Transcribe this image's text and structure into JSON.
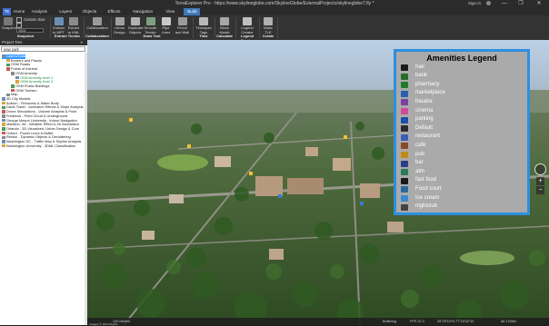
{
  "window": {
    "title": "TerraExplorer Pro - https://www.skylineglobe.com/SkylineGlobe/ExternalProjects/skylineglobe7.fly *",
    "sign_in": "Sign In",
    "minimize": "—",
    "maximize": "❐",
    "close": "✕"
  },
  "menu": {
    "logo": "TE",
    "items": [
      "Home",
      "Analysis",
      "Layers",
      "Objects",
      "Effects",
      "Navigation",
      "View",
      "Build"
    ],
    "active_index": 7
  },
  "ribbon": {
    "snapshot_label": "Snapshot",
    "custom_size_label": "Custom Size",
    "checkbox_extra_label": "",
    "size_value": "1024",
    "groups": {
      "snapshot": "Snapshot",
      "extract": "Extract Terrain",
      "collab": "Collaboration",
      "draw": "Draw Tool",
      "time": "Time",
      "calc": "Calculate",
      "legend": "Legend Creator",
      "create": "Create"
    },
    "buttons": [
      {
        "label": "Extract to MPT",
        "icon": "extract-icon"
      },
      {
        "label": "Extract to KML",
        "icon": "extract-kml-icon"
      },
      {
        "label": "Collaboration",
        "icon": "collaboration-icon"
      },
      {
        "label": "Urban Design",
        "icon": "urban-icon"
      },
      {
        "label": "Duplicate Objects",
        "icon": "duplicate-icon"
      },
      {
        "label": "Smooth Terrain",
        "icon": "terrain-icon"
      },
      {
        "label": "Pipe Lines",
        "icon": "pipe-icon"
      },
      {
        "label": "Fence and Wall",
        "icon": "fence-icon"
      },
      {
        "label": "Timespan Tags",
        "icon": "timespan-icon"
      },
      {
        "label": "Block Model",
        "icon": "block-icon"
      },
      {
        "label": "Legend Creator",
        "icon": "legend-icon"
      },
      {
        "label": "Make TLE",
        "icon": "tle-icon"
      }
    ]
  },
  "project_tree": {
    "header": "Project Tree",
    "search_value": "new york",
    "rows": [
      {
        "label": "Layers/Data",
        "indent": 0,
        "selected": true,
        "color": ""
      },
      {
        "label": "Borders and Places",
        "indent": 1,
        "selected": false,
        "color": ""
      },
      {
        "label": "OSM Roads",
        "indent": 1,
        "selected": false,
        "color": ""
      },
      {
        "label": "Points of Interest",
        "indent": 1,
        "selected": false,
        "color": ""
      },
      {
        "label": "OSM Amenity",
        "indent": 2,
        "selected": false,
        "color": ""
      },
      {
        "label": "OSM Amenity level 1",
        "indent": 3,
        "selected": false,
        "color": "green"
      },
      {
        "label": "OSM Amenity level 2",
        "indent": 3,
        "selected": false,
        "color": "green"
      },
      {
        "label": "OSM Public Buildings",
        "indent": 2,
        "selected": false,
        "color": ""
      },
      {
        "label": "OSM Tourism",
        "indent": 2,
        "selected": false,
        "color": ""
      },
      {
        "label": "Map",
        "indent": 1,
        "selected": false,
        "color": ""
      },
      {
        "label": "3D City Models",
        "indent": 0,
        "selected": false,
        "color": ""
      },
      {
        "label": "Auburn - Fireworks & Water Body",
        "indent": 0,
        "selected": false,
        "color": ""
      },
      {
        "label": "Davis Tower - Animation Effects & Slope Analysis",
        "indent": 0,
        "selected": false,
        "color": ""
      },
      {
        "label": "Drone Simulations - Volume Analysis & Point",
        "indent": 0,
        "selected": false,
        "color": ""
      },
      {
        "label": "Frederick - Point Cloud & Underground",
        "indent": 0,
        "selected": false,
        "color": ""
      },
      {
        "label": "George Mason University - Indoor Navigation",
        "indent": 0,
        "selected": false,
        "color": ""
      },
      {
        "label": "Madison, WI - Weather Effect & 3D Annotation",
        "indent": 0,
        "selected": false,
        "color": ""
      },
      {
        "label": "Orlando - 3D Visualized, Urban Design & Com",
        "indent": 0,
        "selected": false,
        "color": ""
      },
      {
        "label": "Oxford - Power Lines & Buffer",
        "indent": 0,
        "selected": false,
        "color": ""
      },
      {
        "label": "Reston - Dynamic Objects & Decluttering",
        "indent": 0,
        "selected": false,
        "color": ""
      },
      {
        "label": "Washington DC - Traffic Map & Skyline Analysis",
        "indent": 0,
        "selected": false,
        "color": ""
      },
      {
        "label": "Washington University - 3DML Classification",
        "indent": 0,
        "selected": false,
        "color": ""
      }
    ]
  },
  "legend": {
    "title": "Amenities Legend",
    "items": [
      {
        "label": "fuel",
        "icon": "fuel-icon",
        "color": "#1a1a1a"
      },
      {
        "label": "bank",
        "icon": "bank-icon",
        "color": "#2a6a2a"
      },
      {
        "label": "pharmacy",
        "icon": "pharmacy-icon",
        "color": "#1d7d2d"
      },
      {
        "label": "marketplace",
        "icon": "marketplace-icon",
        "color": "#2a5fb0"
      },
      {
        "label": "theatre",
        "icon": "theatre-icon",
        "color": "#7a3fa0"
      },
      {
        "label": "cinema",
        "icon": "cinema-icon",
        "color": "#d04a9a"
      },
      {
        "label": "parking",
        "icon": "parking-icon",
        "color": "#1e4fa8"
      },
      {
        "label": "Default",
        "icon": "default-icon",
        "color": "#2a2a2a"
      },
      {
        "label": "restaurant",
        "icon": "restaurant-icon",
        "color": "#3a5fb8"
      },
      {
        "label": "cafe",
        "icon": "cafe-icon",
        "color": "#8a4a2a"
      },
      {
        "label": "pub",
        "icon": "pub-icon",
        "color": "#c08a1a"
      },
      {
        "label": "bar",
        "icon": "bar-icon",
        "color": "#2a3f8a"
      },
      {
        "label": "atm",
        "icon": "atm-icon",
        "color": "#2a7a5a"
      },
      {
        "label": "fast food",
        "icon": "fastfood-icon",
        "color": "#1a1a1a"
      },
      {
        "label": "Food court",
        "icon": "foodcourt-icon",
        "color": "#2a6a9a"
      },
      {
        "label": "Ice cream",
        "icon": "icecream-icon",
        "color": "#3a8ad0"
      },
      {
        "label": "nightclub",
        "icon": "nightclub-icon",
        "color": "#444444"
      }
    ]
  },
  "status": {
    "scale_text": "120 Meters",
    "copyright": "Imagery © 2019 Skyline",
    "buffering": "Buffering",
    "fps": "FPS 22.2",
    "coords": "39°25'10\"N 77°24'41\"W",
    "alt": "Alt 1205m"
  }
}
